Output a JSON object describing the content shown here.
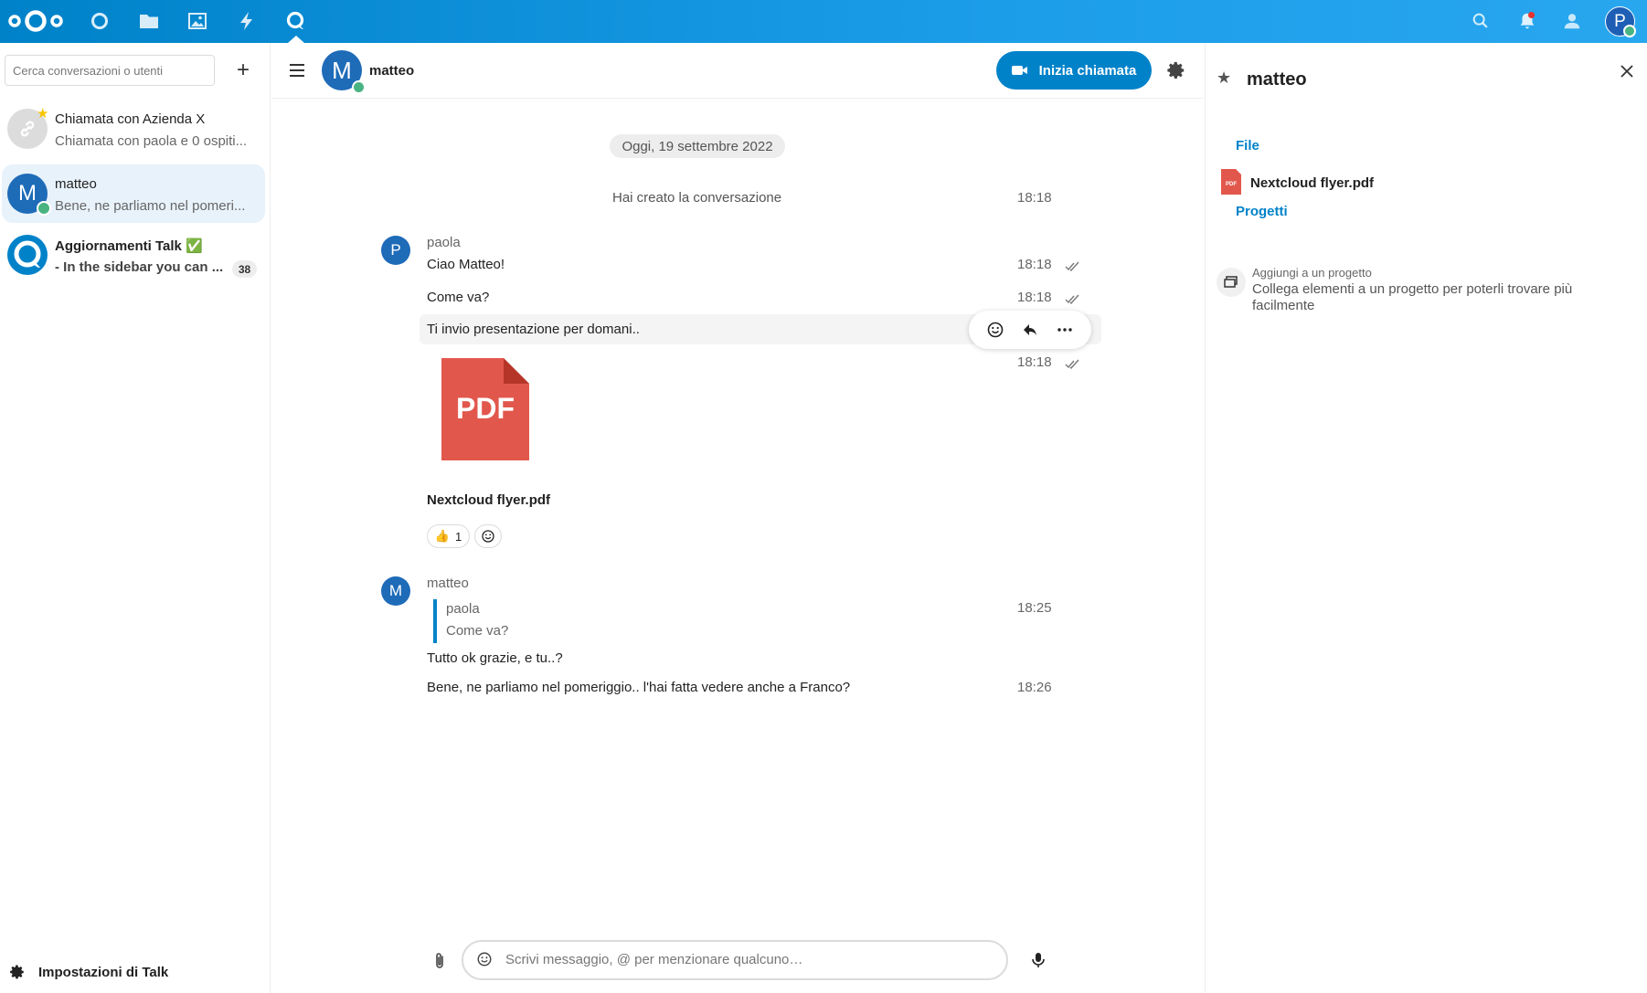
{
  "header": {
    "apps": [
      "dashboard-icon",
      "files-icon",
      "photos-icon",
      "activity-icon",
      "talk-icon"
    ],
    "user_initial": "P"
  },
  "sidebar": {
    "search_placeholder": "Cerca conversazioni o utenti",
    "add_label": "+",
    "conversations": [
      {
        "name": "Chiamata con Azienda X",
        "sub": "Chiamata con paola e 0 ospiti...",
        "favorite": true
      },
      {
        "name": "matteo",
        "sub": "Bene, ne parliamo nel pomeri...",
        "initial": "M",
        "active": true
      },
      {
        "name": "Aggiornamenti Talk ✅",
        "sub": "- In the sidebar you can ...",
        "badge": "38"
      }
    ],
    "settings_label": "Impostazioni di Talk"
  },
  "chat": {
    "title": "matteo",
    "avatar_initial": "M",
    "call_button": "Inizia chiamata",
    "date_separator": "Oggi, 19 settembre 2022",
    "system_message": "Hai creato la conversazione",
    "system_time": "18:18",
    "messages": [
      {
        "author": "paola",
        "initial": "P",
        "text": "Ciao Matteo!",
        "time": "18:18"
      },
      {
        "text": "Come va?",
        "time": "18:18"
      },
      {
        "text": "Ti invio presentazione per domani..",
        "time": "18:18"
      },
      {
        "file": "Nextcloud flyer.pdf",
        "file_icon_label": "PDF",
        "reactions": [
          {
            "emoji": "👍",
            "count": "1"
          }
        ]
      },
      {
        "author": "matteo",
        "initial": "M",
        "quote_author": "paola",
        "quote_text": "Come va?",
        "time": "18:25"
      },
      {
        "text": "Tutto ok grazie, e tu..?"
      },
      {
        "text": "Bene, ne parliamo nel pomeriggio.. l'hai fatta vedere anche a Franco?",
        "time": "18:26"
      }
    ],
    "composer_placeholder": "Scrivi messaggio, @ per menzionare qualcuno…"
  },
  "right_sidebar": {
    "title": "matteo",
    "files_section": "File",
    "file_name": "Nextcloud flyer.pdf",
    "file_icon_label": "PDF",
    "projects_section": "Progetti",
    "projects_heading": "Aggiungi a un progetto",
    "projects_description": "Collega elementi a un progetto per poterli trovare più facilmente"
  },
  "colors": {
    "primary": "#0082c9",
    "online": "#49b382",
    "pdf": "#e2574c"
  }
}
